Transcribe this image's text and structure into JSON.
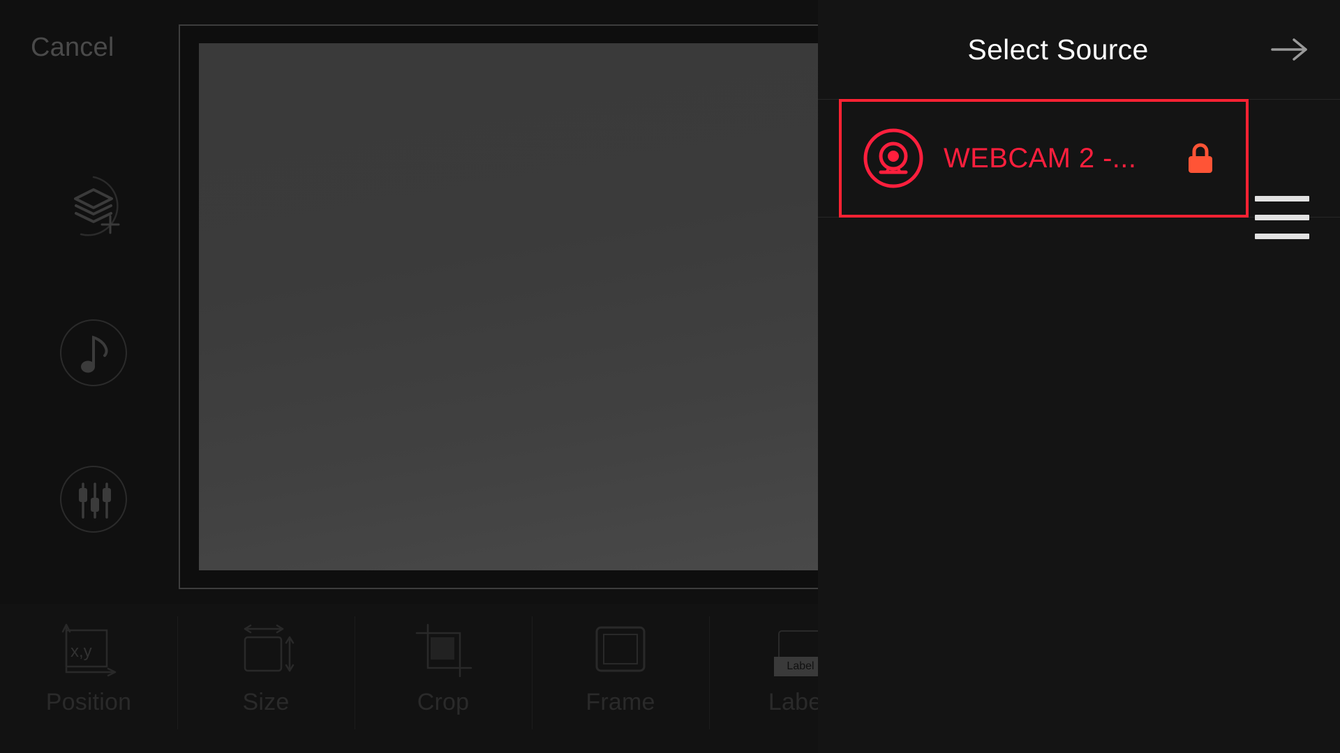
{
  "editor": {
    "cancel_label": "Cancel",
    "side_tools": [
      {
        "name": "add-layer",
        "icon": "layers-plus-icon"
      },
      {
        "name": "audio",
        "icon": "music-note-icon"
      },
      {
        "name": "levels",
        "icon": "sliders-icon"
      }
    ],
    "bottom_tools": [
      {
        "label": "Position",
        "icon": "position-xy-icon",
        "badge": "x,y"
      },
      {
        "label": "Size",
        "icon": "size-arrows-icon"
      },
      {
        "label": "Crop",
        "icon": "crop-icon"
      },
      {
        "label": "Frame",
        "icon": "frame-icon"
      },
      {
        "label": "Label",
        "icon": "label-icon",
        "thumb_text": "Label"
      }
    ]
  },
  "panel": {
    "title": "Select Source",
    "next_icon": "arrow-right-icon",
    "menu_icon": "hamburger-menu-icon",
    "source": {
      "name": "WEBCAM 2 -...",
      "icon": "webcam-icon",
      "lock_icon": "lock-icon",
      "selected": true
    }
  },
  "colors": {
    "accent_red": "#ff2233",
    "source_text_red": "#ff1f3d",
    "lock_orange": "#ff5436",
    "panel_bg": "#141414",
    "editor_bg": "#101010"
  }
}
